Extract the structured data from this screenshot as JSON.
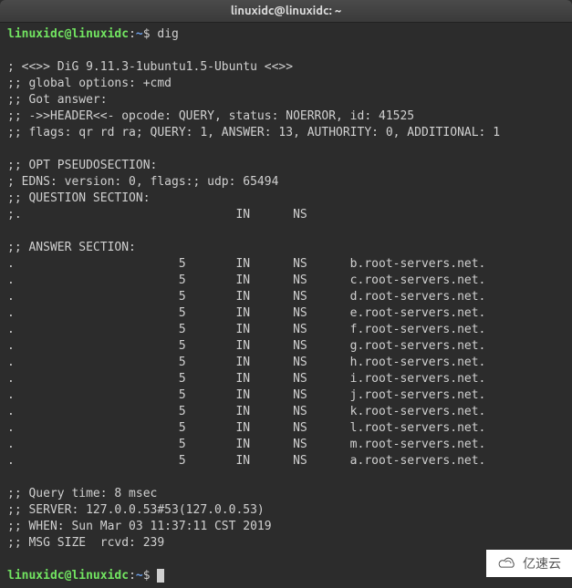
{
  "window": {
    "title": "linuxidc@linuxidc: ~"
  },
  "prompt": {
    "user": "linuxidc",
    "at": "@",
    "host": "linuxidc",
    "colon": ":",
    "path": "~",
    "dollar": "$ "
  },
  "command1": "dig",
  "empty": "",
  "out": {
    "l1": "; <<>> DiG 9.11.3-1ubuntu1.5-Ubuntu <<>>",
    "l2": ";; global options: +cmd",
    "l3": ";; Got answer:",
    "l4": ";; ->>HEADER<<- opcode: QUERY, status: NOERROR, id: 41525",
    "l5": ";; flags: qr rd ra; QUERY: 1, ANSWER: 13, AUTHORITY: 0, ADDITIONAL: 1",
    "l6": "",
    "l7": ";; OPT PSEUDOSECTION:",
    "l8": "; EDNS: version: 0, flags:; udp: 65494",
    "l9": ";; QUESTION SECTION:",
    "l10": ";.                              IN      NS",
    "l11": "",
    "l12": ";; ANSWER SECTION:",
    "a1": ".                       5       IN      NS      b.root-servers.net.",
    "a2": ".                       5       IN      NS      c.root-servers.net.",
    "a3": ".                       5       IN      NS      d.root-servers.net.",
    "a4": ".                       5       IN      NS      e.root-servers.net.",
    "a5": ".                       5       IN      NS      f.root-servers.net.",
    "a6": ".                       5       IN      NS      g.root-servers.net.",
    "a7": ".                       5       IN      NS      h.root-servers.net.",
    "a8": ".                       5       IN      NS      i.root-servers.net.",
    "a9": ".                       5       IN      NS      j.root-servers.net.",
    "a10": ".                       5       IN      NS      k.root-servers.net.",
    "a11": ".                       5       IN      NS      l.root-servers.net.",
    "a12": ".                       5       IN      NS      m.root-servers.net.",
    "a13": ".                       5       IN      NS      a.root-servers.net.",
    "f1": "",
    "f2": ";; Query time: 8 msec",
    "f3": ";; SERVER: 127.0.0.53#53(127.0.0.53)",
    "f4": ";; WHEN: Sun Mar 03 11:37:11 CST 2019",
    "f5": ";; MSG SIZE  rcvd: 239",
    "f6": ""
  },
  "watermark": "亿速云"
}
